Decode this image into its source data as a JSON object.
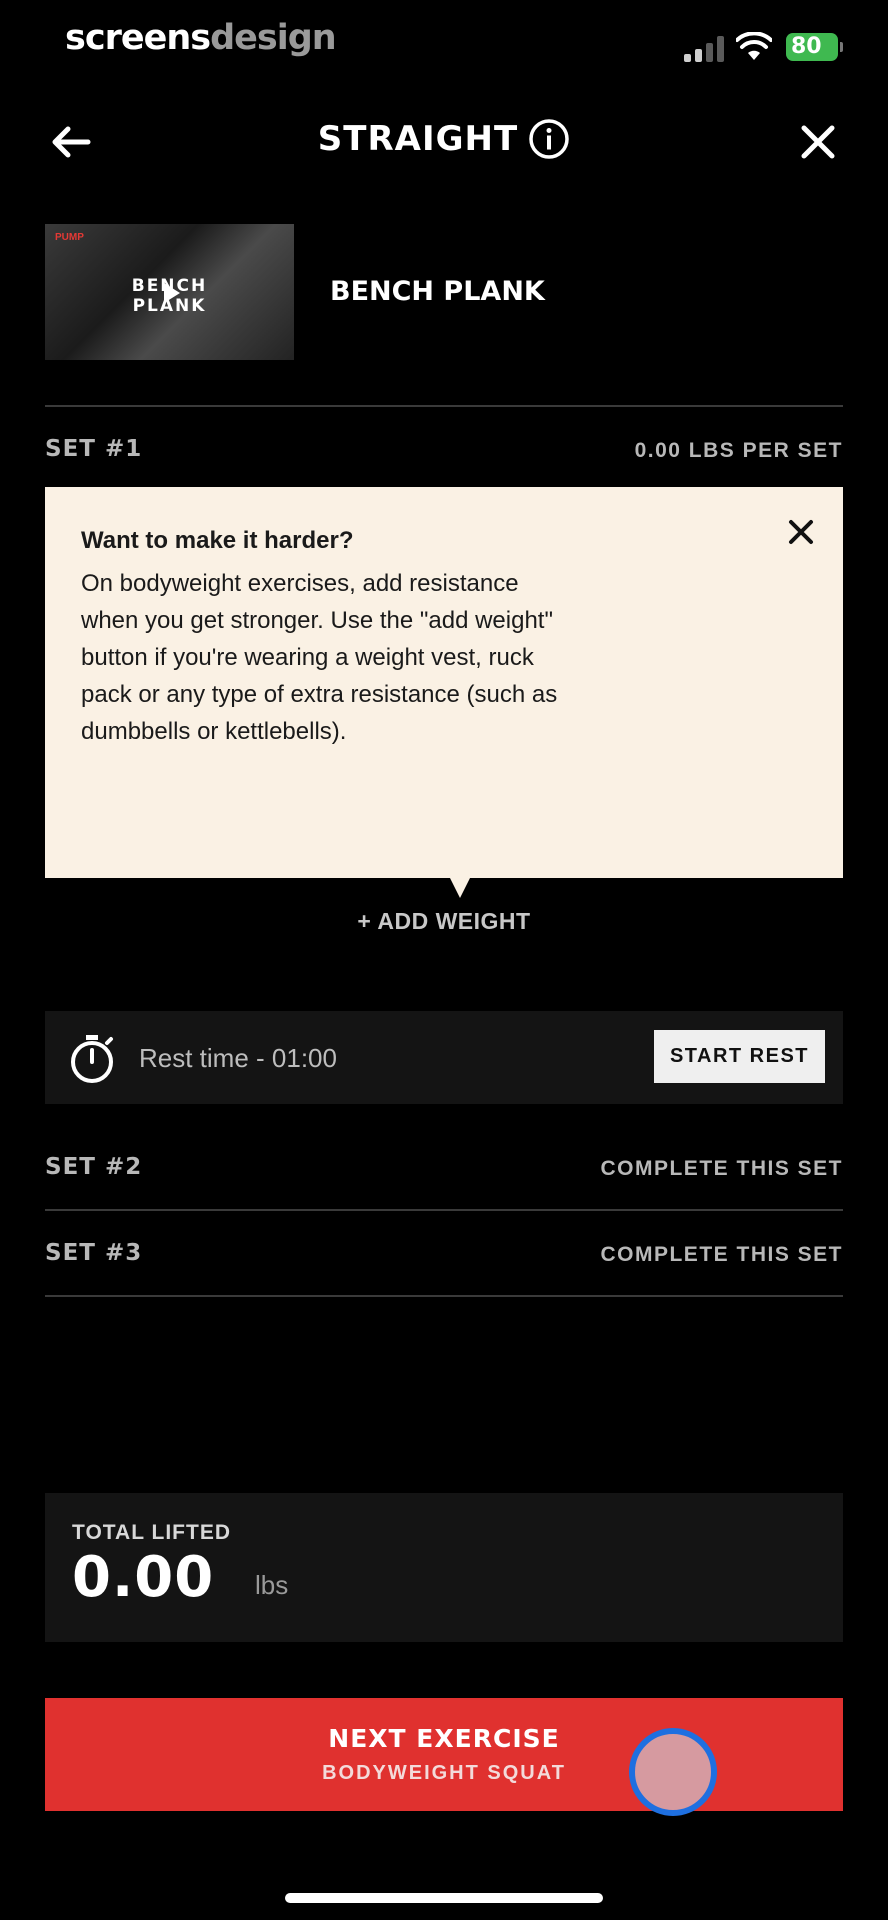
{
  "status_bar": {
    "brand_part1": "screens",
    "brand_part2": "design",
    "battery": "80"
  },
  "header": {
    "title": "STRAIGHT",
    "icons": {
      "back": "arrow-left-icon",
      "info": "info-circle-icon",
      "close": "close-icon"
    }
  },
  "exercise": {
    "name": "BENCH PLANK",
    "thumbnail_logo": "PUMP",
    "thumbnail_line1": "BENCH",
    "thumbnail_line2": "PLANK"
  },
  "sets": [
    {
      "label": "SET #1",
      "right": "0.00 LBS PER SET"
    },
    {
      "label": "SET #2",
      "right": "COMPLETE THIS SET"
    },
    {
      "label": "SET #3",
      "right": "COMPLETE THIS SET"
    }
  ],
  "tooltip": {
    "title": "Want to make it harder?",
    "body": "On bodyweight exercises, add resistance when you get stronger. Use the \"add weight\" button if you're wearing a weight vest, ruck pack or any type of extra resistance (such as dumbbells or kettlebells)."
  },
  "add_weight_label": "+ ADD WEIGHT",
  "rest": {
    "text": "Rest time - 01:00",
    "button_label": "START REST"
  },
  "total": {
    "label": "TOTAL LIFTED",
    "value": "0.00",
    "unit": "lbs"
  },
  "next": {
    "title": "NEXT EXERCISE",
    "subtitle": "BODYWEIGHT SQUAT"
  },
  "colors": {
    "accent_red": "#e0312f",
    "tooltip_bg": "#faf1e4",
    "card_bg": "#141414",
    "battery_green": "#3fb950"
  }
}
